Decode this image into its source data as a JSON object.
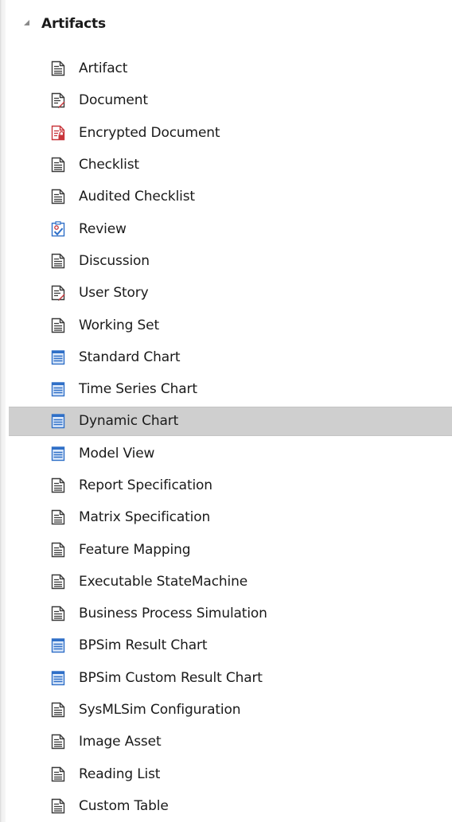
{
  "toolbox": {
    "group": {
      "title": "Artifacts",
      "expanded": true
    },
    "items": [
      {
        "label": "Artifact",
        "icon": "document-icon"
      },
      {
        "label": "Document",
        "icon": "document-edit-icon"
      },
      {
        "label": "Encrypted Document",
        "icon": "encrypted-document-icon"
      },
      {
        "label": "Checklist",
        "icon": "document-icon"
      },
      {
        "label": "Audited Checklist",
        "icon": "document-icon"
      },
      {
        "label": "Review",
        "icon": "review-icon"
      },
      {
        "label": "Discussion",
        "icon": "document-icon"
      },
      {
        "label": "User Story",
        "icon": "document-edit-icon"
      },
      {
        "label": "Working Set",
        "icon": "document-icon"
      },
      {
        "label": "Standard Chart",
        "icon": "chart-icon"
      },
      {
        "label": "Time Series Chart",
        "icon": "chart-icon"
      },
      {
        "label": "Dynamic Chart",
        "icon": "chart-icon",
        "selected": true
      },
      {
        "label": "Model View",
        "icon": "chart-icon"
      },
      {
        "label": "Report Specification",
        "icon": "document-icon"
      },
      {
        "label": "Matrix Specification",
        "icon": "document-icon"
      },
      {
        "label": "Feature Mapping",
        "icon": "document-icon"
      },
      {
        "label": "Executable StateMachine",
        "icon": "document-icon"
      },
      {
        "label": "Business Process Simulation",
        "icon": "document-icon"
      },
      {
        "label": "BPSim Result Chart",
        "icon": "chart-icon"
      },
      {
        "label": "BPSim Custom Result Chart",
        "icon": "chart-icon"
      },
      {
        "label": "SysMLSim Configuration",
        "icon": "document-icon"
      },
      {
        "label": "Image Asset",
        "icon": "document-icon"
      },
      {
        "label": "Reading List",
        "icon": "document-icon"
      },
      {
        "label": "Custom Table",
        "icon": "document-icon"
      }
    ]
  },
  "colors": {
    "selected_background": "#cfcfcf",
    "chart_icon_blue": "#2f6fc7",
    "encrypted_icon_red": "#c8353a",
    "review_icon_blue": "#2f6fc7"
  }
}
